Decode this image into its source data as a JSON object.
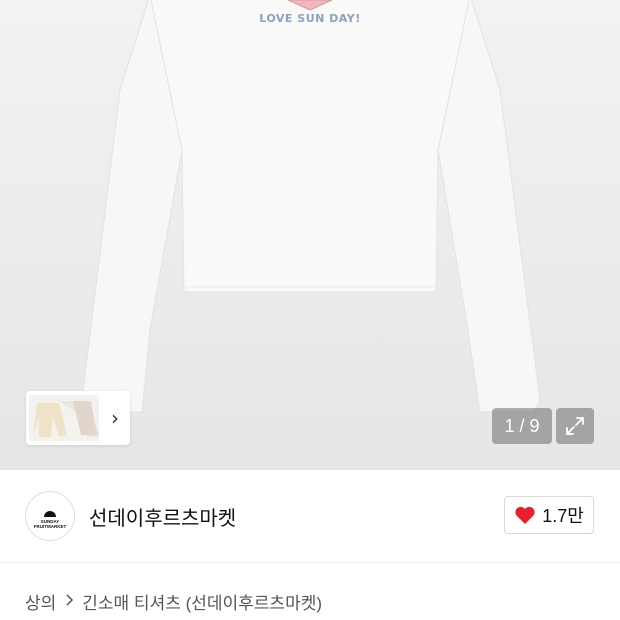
{
  "product": {
    "print_text": "LOVE SUN DAY!",
    "image_counter": "1 / 9"
  },
  "shop": {
    "logo_text_line1": "SUNDAY",
    "logo_text_line2": "FRUITMARKET",
    "name": "선데이후르츠마켓",
    "like_count": "1.7만"
  },
  "breadcrumb": {
    "category": "상의",
    "subcategory": "긴소매 티셔츠 (선데이후르츠마켓)"
  },
  "colors": {
    "heart": "#e8202a",
    "print": "#8aa2c0"
  },
  "icons": {
    "thumb_next": "chevron-right-icon",
    "expand": "expand-arrows-icon",
    "like": "heart-icon",
    "breadcrumb_sep": "chevron-right-icon"
  }
}
